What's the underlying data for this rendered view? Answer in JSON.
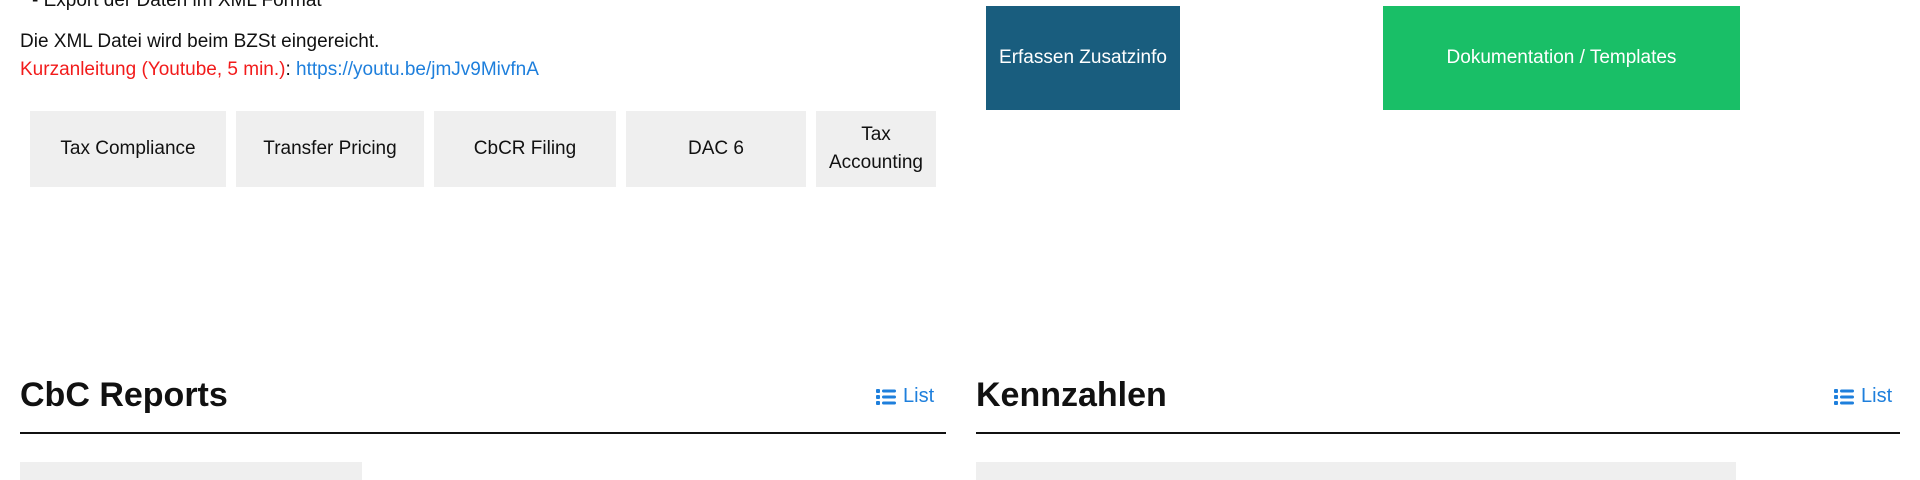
{
  "top": {
    "cut_text": "Export der Daten im XML Format",
    "line_submission": "Die XML Datei wird beim BZSt eingereicht.",
    "quick_guide": "Kurzanleitung (Youtube, 5 min.)",
    "colon": ":",
    "youtube_link": "https://youtu.be/jmJv9MivfnA"
  },
  "tiles": [
    "Tax Compliance",
    "Transfer Pricing",
    "CbCR Filing",
    "DAC 6",
    "Tax Accounting"
  ],
  "buttons": {
    "capture_additional_info": "Erfassen Zusatzinfo",
    "documentation_templates": "Dokumentation / Templates"
  },
  "sections": {
    "cbc_reports": {
      "title": "CbC Reports",
      "list_label": "List"
    },
    "kennzahlen": {
      "title": "Kennzahlen",
      "list_label": "List"
    }
  },
  "colors": {
    "link": "#1e7fdc",
    "red_text": "#f21b1b",
    "primary_dark": "#195d7e",
    "primary_green": "#19bf67",
    "tile_background": "#efefef"
  },
  "icons": {
    "list": "list-icon"
  }
}
